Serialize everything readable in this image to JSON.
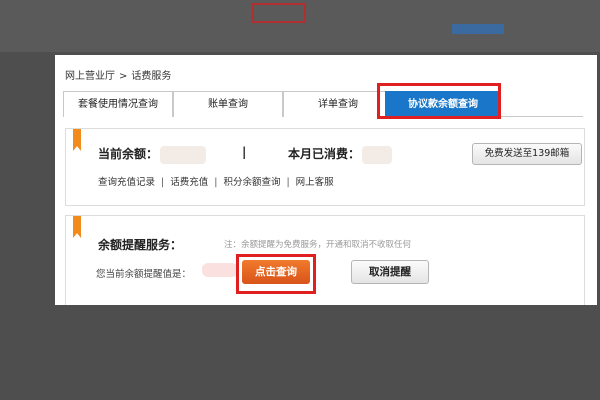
{
  "breadcrumb": {
    "home": "网上营业厅",
    "separator": ">",
    "current": "话费服务"
  },
  "tabs": [
    {
      "label": "套餐使用情况查询"
    },
    {
      "label": "账单查询"
    },
    {
      "label": "详单查询"
    },
    {
      "label": "协议款余额查询"
    }
  ],
  "balance": {
    "current_label": "当前余额：",
    "divider": "|",
    "month_label": "本月已消费：",
    "send_button": "免费发送至139邮箱"
  },
  "links": [
    {
      "label": "查询充值记录"
    },
    {
      "label": "话费充值"
    },
    {
      "label": "积分余额查询"
    },
    {
      "label": "网上客服"
    }
  ],
  "link_separator": "|",
  "reminder": {
    "title": "余额提醒服务：",
    "note": "注：余额提醒为免费服务，开通和取消不收取任何",
    "threshold_label": "您当前余额提醒值是：",
    "query_button": "点击查询",
    "cancel_button": "取消提醒"
  },
  "colors": {
    "active_tab": "#1976c8",
    "highlight_outline": "#e02020",
    "primary_button": "#e8672a",
    "flag": "#f08b1c"
  }
}
